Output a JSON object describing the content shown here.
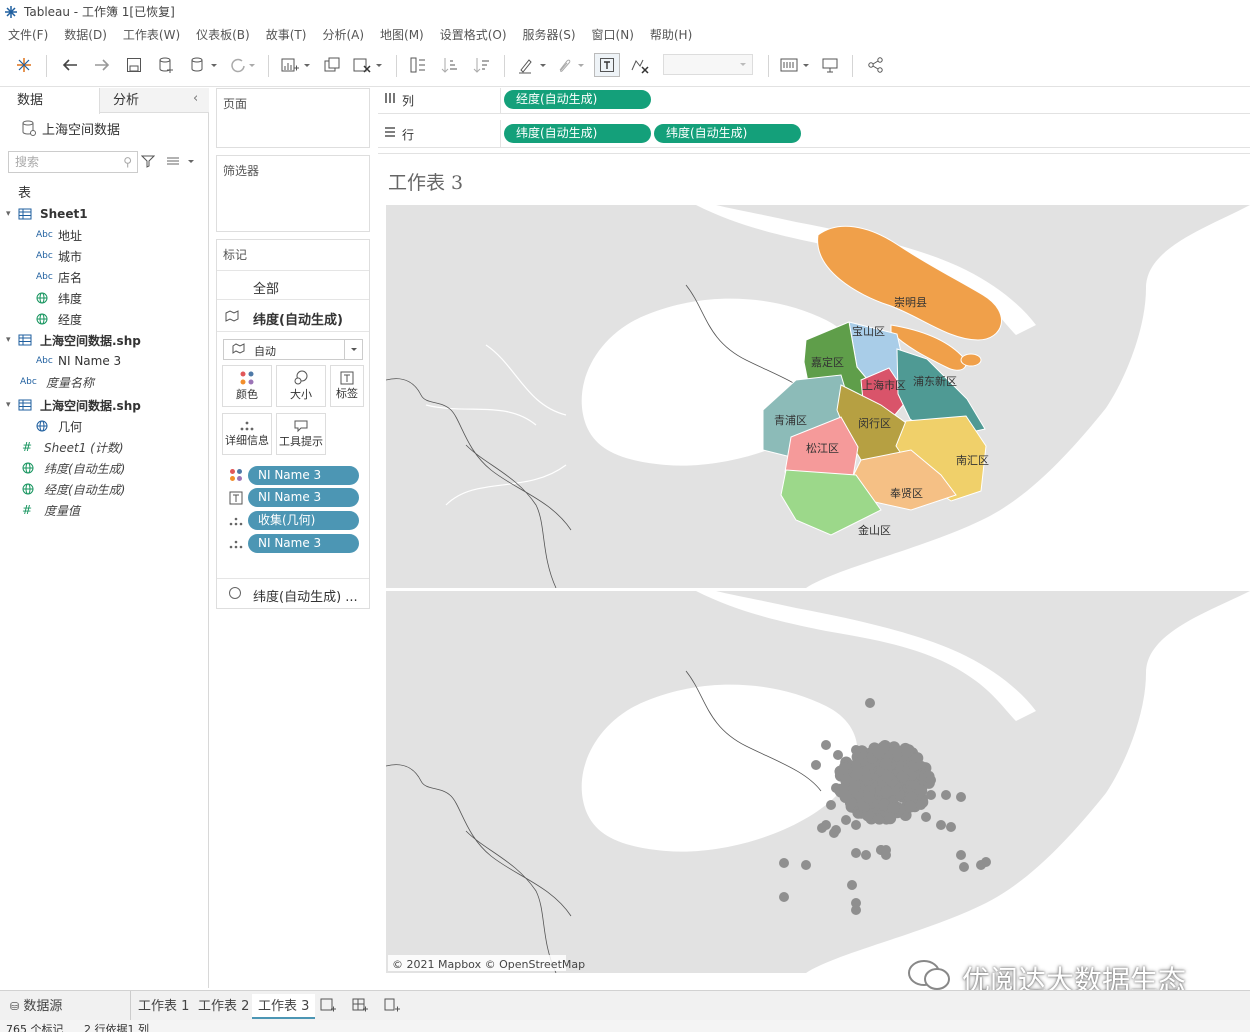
{
  "window": {
    "title": "Tableau - 工作簿 1[已恢复]"
  },
  "menu": [
    "文件(F)",
    "数据(D)",
    "工作表(W)",
    "仪表板(B)",
    "故事(T)",
    "分析(A)",
    "地图(M)",
    "设置格式(O)",
    "服务器(S)",
    "窗口(N)",
    "帮助(H)"
  ],
  "left_pane": {
    "tab_data": "数据",
    "tab_analysis": "分析",
    "datasource": "上海空间数据",
    "search_placeholder": "搜索",
    "section_tables": "表",
    "sheet1": "Sheet1",
    "fields_sheet1": [
      "地址",
      "城市",
      "店名"
    ],
    "geo_fields_sheet1": [
      "纬度",
      "经度"
    ],
    "shp1": "上海空间数据.shp",
    "shp1_field": "NI Name 3",
    "measure_names": "度量名称",
    "shp2": "上海空间数据.shp",
    "shp2_field": "几何",
    "measures": [
      "Sheet1 (计数)",
      "纬度(自动生成)",
      "经度(自动生成)",
      "度量值"
    ],
    "abc_tag": "Abc"
  },
  "shelves": {
    "pages": "页面",
    "filters": "筛选器",
    "marks": "标记",
    "marks_all": "全部",
    "marks_layer1": "纬度(自动生成)",
    "mark_type": "自动",
    "buttons": {
      "color": "颜色",
      "size": "大小",
      "label": "标签",
      "detail": "详细信息",
      "tooltip": "工具提示"
    },
    "mark_pills": [
      "NI Name 3",
      "NI Name 3",
      "收集(几何)",
      "NI Name 3"
    ],
    "marks_layer2": "纬度(自动生成) ...",
    "columns_label": "列",
    "rows_label": "行",
    "columns_pill": "经度(自动生成)",
    "rows_pills": [
      "纬度(自动生成)",
      "纬度(自动生成)"
    ]
  },
  "viz": {
    "title": "工作表 3",
    "districts": [
      "崇明县",
      "宝山区",
      "嘉定区",
      "上海市区",
      "浦东新区",
      "青浦区",
      "闵行区",
      "松江区",
      "南汇区",
      "奉贤区",
      "金山区"
    ],
    "attribution": "© 2021 Mapbox © OpenStreetMap",
    "watermark": "优阅达大数据生态"
  },
  "sheet_tabs": {
    "datasource": "数据源",
    "sheets": [
      "工作表 1",
      "工作表 2",
      "工作表 3"
    ]
  },
  "status": {
    "marks": "765 个标记",
    "rows": "2 行依据1 列"
  },
  "colors": {
    "accent_green": "#14a07a",
    "pill_blue": "#4c96b4"
  }
}
